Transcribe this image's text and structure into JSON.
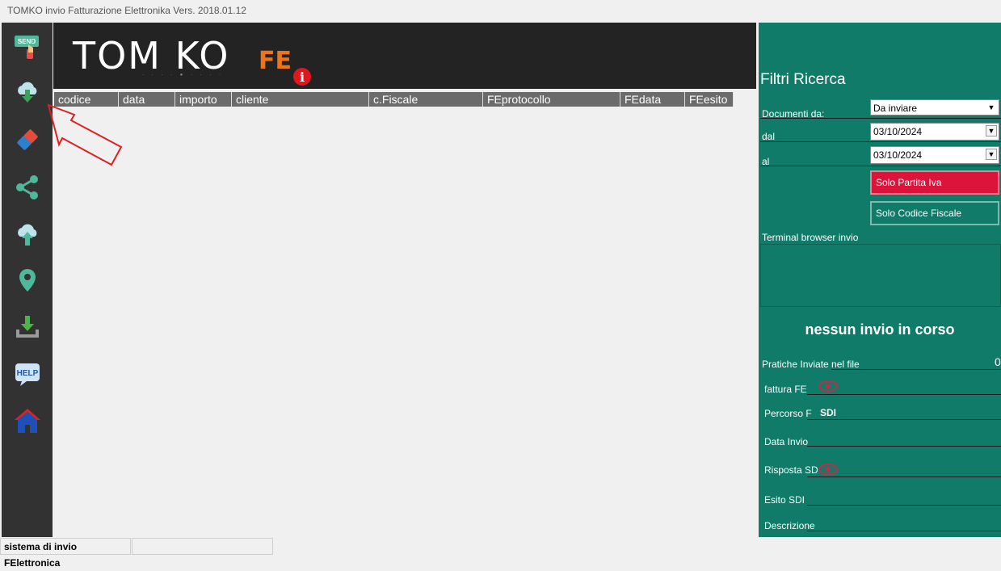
{
  "window": {
    "title": "TOMKO invio Fatturazione Elettronika Vers. 2018.01.12"
  },
  "toolbar": {
    "items": [
      {
        "icon": "send-icon",
        "label": "SEND"
      },
      {
        "icon": "cloud-download-icon"
      },
      {
        "icon": "eraser-icon"
      },
      {
        "icon": "share-icon"
      },
      {
        "icon": "cloud-upload-icon"
      },
      {
        "icon": "location-pin-icon"
      },
      {
        "icon": "download-tray-icon"
      },
      {
        "icon": "help-icon",
        "label": "HELP"
      },
      {
        "icon": "home-icon"
      }
    ]
  },
  "header": {
    "logo_text": "TOM KO",
    "logo_fe": "FE",
    "info_glyph": "i"
  },
  "grid": {
    "columns": [
      "codice",
      "data",
      "importo",
      "cliente",
      "c.Fiscale",
      "FEprotocollo",
      "FEdata",
      "FEesito"
    ]
  },
  "filters": {
    "title": "Filtri Ricerca",
    "documenti_label": "Documenti da:",
    "documenti_value": "Da inviare",
    "dal_label": "dal",
    "dal_value": "03/10/2024",
    "al_label": "al",
    "al_value": "03/10/2024",
    "solo_partita_iva": "Solo Partita Iva",
    "solo_codice_fiscale": "Solo Codice Fiscale",
    "terminal_label": "Terminal browser invio",
    "status_message": "nessun invio in corso",
    "pratiche_label": "Pratiche Inviate nel file",
    "pratiche_count": "0",
    "fattura_label": "fattura FE",
    "percorso_label": "Percorso F",
    "percorso_value": "SDI",
    "data_invio_label": "Data Invio",
    "risposta_label": "Risposta SD",
    "esito_label": "Esito SDI",
    "descrizione_label": "Descrizione"
  },
  "statusbar": {
    "text": "sistema di invio FElettronica"
  },
  "colors": {
    "accent_green": "#0f7b68",
    "button_red": "#dc143c",
    "toolbar": "#323232",
    "header": "#232323"
  }
}
